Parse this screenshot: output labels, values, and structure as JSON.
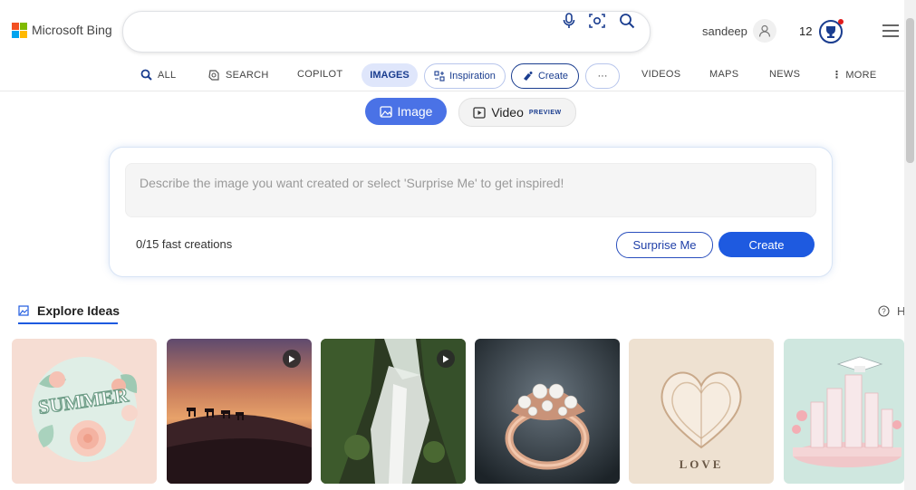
{
  "header": {
    "logo_text": "Microsoft Bing",
    "search_value": "",
    "user_name": "sandeep",
    "rewards_count": "12"
  },
  "nav": {
    "all": "ALL",
    "search": "SEARCH",
    "copilot": "COPILOT",
    "images": "IMAGES",
    "inspiration": "Inspiration",
    "create": "Create",
    "more_dots": "···",
    "videos": "VIDEOS",
    "maps": "MAPS",
    "news": "NEWS",
    "more": "MORE"
  },
  "mode_toggle": {
    "image": "Image",
    "video": "Video",
    "video_badge": "PREVIEW"
  },
  "creator": {
    "placeholder": "Describe the image you want created or select 'Surprise Me' to get inspired!",
    "fast_creations": "0/15 fast creations",
    "surprise_label": "Surprise Me",
    "create_label": "Create"
  },
  "explore": {
    "title": "Explore Ideas",
    "help_partial": "H"
  },
  "thumbnails": [
    {
      "name": "summer-paper-flowers",
      "has_video": false,
      "caption": "SUMMER"
    },
    {
      "name": "desert-camels-sunset",
      "has_video": true,
      "caption": ""
    },
    {
      "name": "forest-waterfall",
      "has_video": true,
      "caption": ""
    },
    {
      "name": "pearl-rose-gold-ring",
      "has_video": false,
      "caption": ""
    },
    {
      "name": "paper-heart-love",
      "has_video": false,
      "caption": "LOVE"
    },
    {
      "name": "pastel-graduation-city",
      "has_video": false,
      "caption": ""
    }
  ],
  "colors": {
    "accent": "#1e5ae0",
    "images_pill_bg": "#dfe6fb",
    "image_toggle_bg": "#4a72e6"
  }
}
